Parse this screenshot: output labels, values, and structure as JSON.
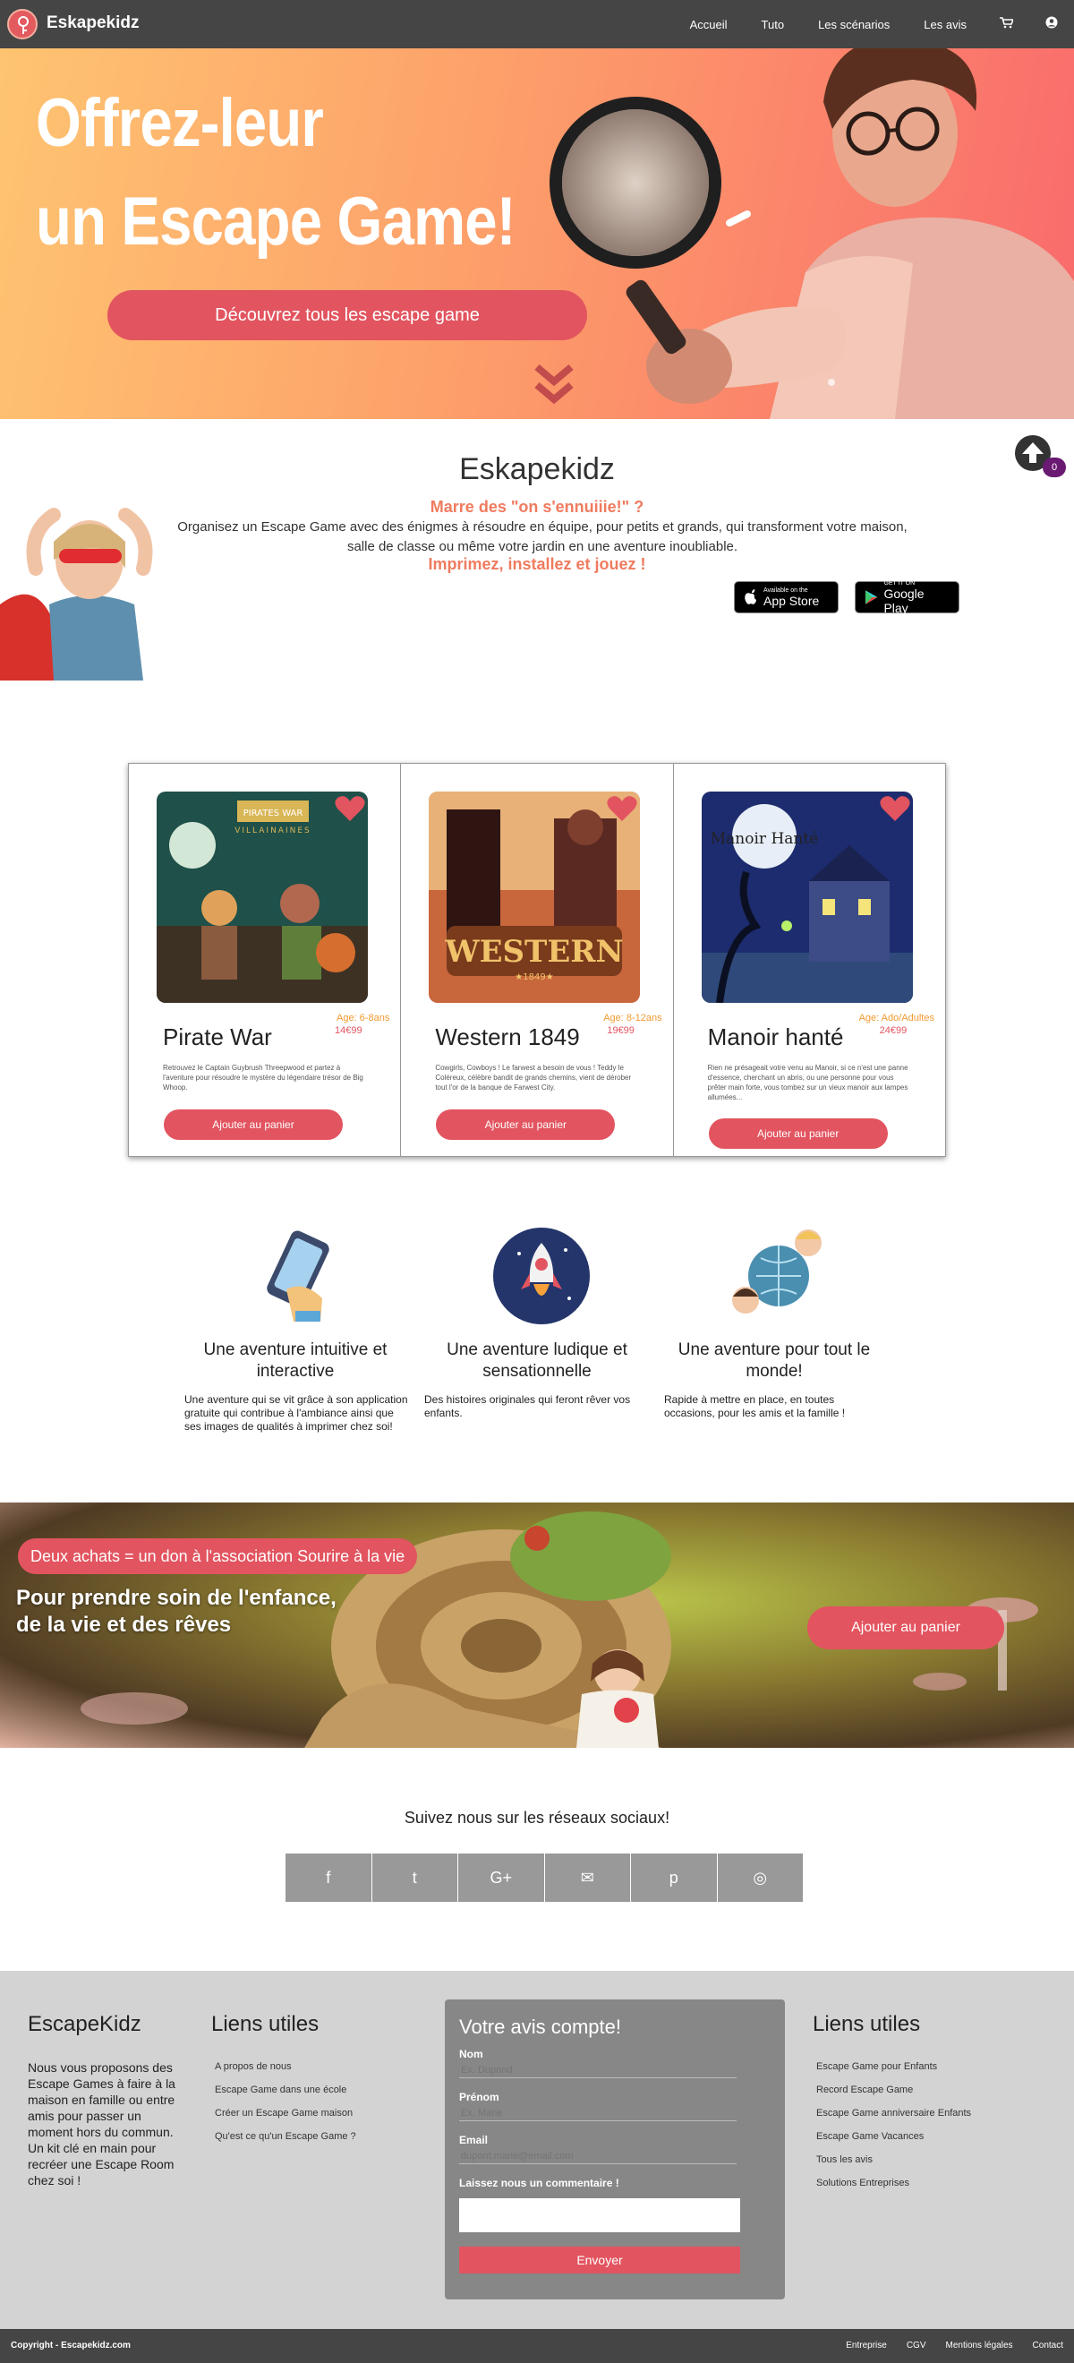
{
  "nav": {
    "brand": "Eskapekidz",
    "items": [
      "Accueil",
      "Tuto",
      "Les scénarios",
      "Les avis"
    ]
  },
  "hero": {
    "title_line1": "Offrez-leur",
    "title_line2": "un Escape Game!",
    "cta": "Découvrez tous les escape game"
  },
  "intro": {
    "title": "Eskapekidz",
    "question": "Marre des \"on s'ennuiiie!\" ?",
    "text": "Organisez un Escape Game avec des énigmes à résoudre en équipe, pour petits et grands, qui transforment votre maison, salle de classe ou même votre jardin en une aventure inoubliable.",
    "call": "Imprimez, installez et jouez !",
    "apple_small": "Available on the",
    "apple_big": "App Store",
    "google_small": "GET IT ON",
    "google_big": "Google Play",
    "cart_count": "0"
  },
  "products": [
    {
      "title": "Pirate War",
      "age": "Age: 6-8ans",
      "price": "14€99",
      "desc": "Retrouvez le Captain Guybrush Threepwood et partez à l'aventure pour résoudre le mystère du légendaire trésor de Big Whoop.",
      "button": "Ajouter au panier",
      "img_text": "PIRATES WAR VILLAINAINES",
      "colors": [
        "#22574f",
        "#3a3226"
      ]
    },
    {
      "title": "Western 1849",
      "age": "Age: 8-12ans",
      "price": "19€99",
      "desc": "Cowgirls, Cowboys ! Le farwest a besoin de vous ! Teddy le Coléreux, célèbre bandit de grands chemins, vient de dérober tout l'or de la banque de Farwest City.",
      "button": "Ajouter au panier",
      "img_text": "WESTERN",
      "colors": [
        "#c7653a",
        "#3b1a16"
      ]
    },
    {
      "title": "Manoir hanté",
      "age": "Age: Ado/Adultes",
      "price": "24€99",
      "desc": "Rien ne présageait votre venu au Manoir, si ce n'est une panne d'essence, cherchant un abris, ou une personne pour vous prêter main forte, vous tombez sur un vieux manoir aux lampes allumées...",
      "button": "Ajouter au panier",
      "img_text": "Manoir Hanté",
      "colors": [
        "#1d2c6e",
        "#0b1235"
      ]
    }
  ],
  "features": [
    {
      "title": "Une aventure intuitive et interactive",
      "text": "Une aventure qui se vit grâce à son application gratuite qui contribue à l'ambiance ainsi que ses images de qualités à imprimer chez soi!"
    },
    {
      "title": "Une aventure ludique et sensationnelle",
      "text": "Des histoires originales qui feront rêver vos enfants."
    },
    {
      "title": "Une aventure pour tout le monde!",
      "text": "Rapide à mettre en place, en toutes occasions, pour les amis et la famille !"
    }
  ],
  "banner": {
    "badge": "Deux achats = un don à l'association Sourire à la vie",
    "line1": "Pour prendre soin de l'enfance,",
    "line2": "de la vie et des rêves",
    "cta": "Ajouter au panier"
  },
  "social": {
    "title": "Suivez nous sur les réseaux sociaux!",
    "items": [
      "f",
      "t",
      "G+",
      "✉",
      "p",
      "◎"
    ]
  },
  "footer": {
    "col1_title": "EscapeKidz",
    "about": "Nous vous proposons des Escape Games à faire à la maison en famille ou entre amis pour passer un moment hors du commun. Un kit clé en main pour recréer une Escape Room chez soi !",
    "col2_title": "Liens utiles",
    "links1": [
      "A propos de nous",
      "Escape Game dans une école",
      "Créer un Escape Game maison",
      "Qu'est ce qu'un Escape Game ?"
    ],
    "form_title": "Votre avis compte!",
    "name_label": "Nom",
    "name_ph": "Ex. Dupond",
    "firstname_label": "Prénom",
    "firstname_ph": "Ex. Marie",
    "email_label": "Email",
    "email_ph": "dupont.marie@email.com",
    "comment_label": "Laissez nous un commentaire !",
    "send": "Envoyer",
    "col4_title": "Liens utiles",
    "links2": [
      "Escape Game pour Enfants",
      "Record Escape Game",
      "Escape Game anniversaire Enfants",
      "Escape Game Vacances",
      "Tous les avis",
      "Solutions Entreprises"
    ]
  },
  "bottom": {
    "copyright": "Copyright - Escapekidz.com",
    "links": [
      "Entreprise",
      "CGV",
      "Mentions légales",
      "Contact"
    ]
  }
}
